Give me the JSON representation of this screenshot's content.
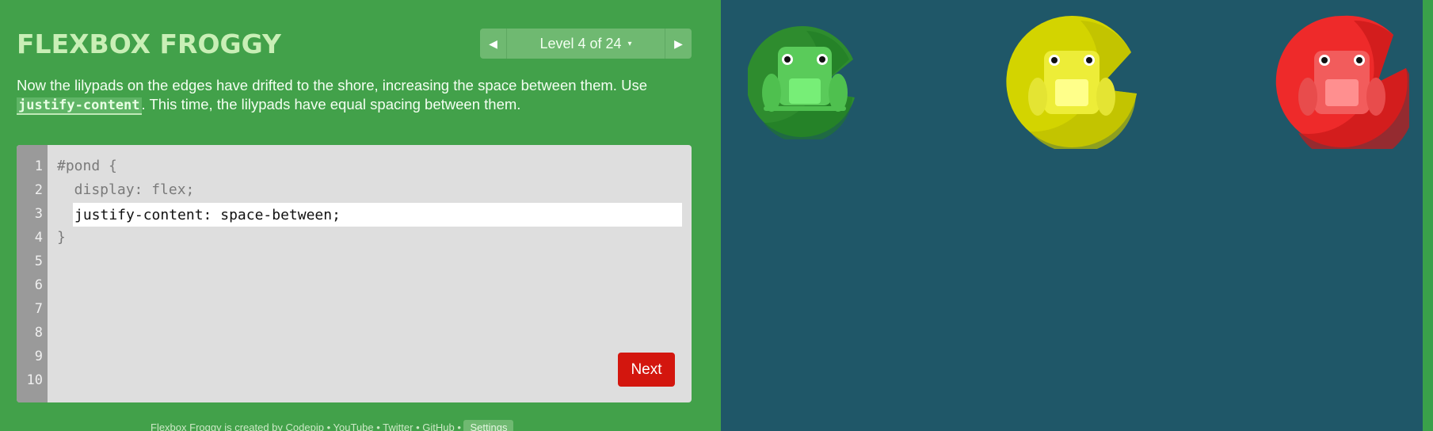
{
  "app": {
    "title": "FLEXBOX FROGGY"
  },
  "level_nav": {
    "prev_icon": "triangle-left-icon",
    "label": "Level 4 of 24",
    "caret": "▾",
    "next_icon": "triangle-right-icon"
  },
  "instructions": {
    "text_before": "Now the lilypads on the edges have drifted to the shore, increasing the space between them. Use ",
    "code": "justify-content",
    "text_after": ". This time, the lilypads have equal spacing between them."
  },
  "editor": {
    "line_numbers": [
      "1",
      "2",
      "3",
      "4",
      "5",
      "6",
      "7",
      "8",
      "9",
      "10"
    ],
    "line1": "#pond {",
    "line2": "  display: flex;",
    "input_value": "justify-content: space-between;",
    "line4": "}",
    "next_label": "Next"
  },
  "footer": {
    "prefix": "Flexbox Froggy is created by ",
    "codepip": "Codepip",
    "sep1": " • ",
    "youtube": "YouTube",
    "sep2": " • ",
    "twitter": "Twitter",
    "sep3": " • ",
    "github": "GitHub",
    "sep4": " • ",
    "settings": "Settings"
  },
  "board": {
    "frogs": [
      {
        "color": "green"
      },
      {
        "color": "yellow"
      },
      {
        "color": "red"
      }
    ]
  },
  "colors": {
    "sidebar_bg": "#42a14a",
    "board_bg": "#1f5768",
    "next_button": "#d3160e",
    "title": "#c9efb6"
  }
}
